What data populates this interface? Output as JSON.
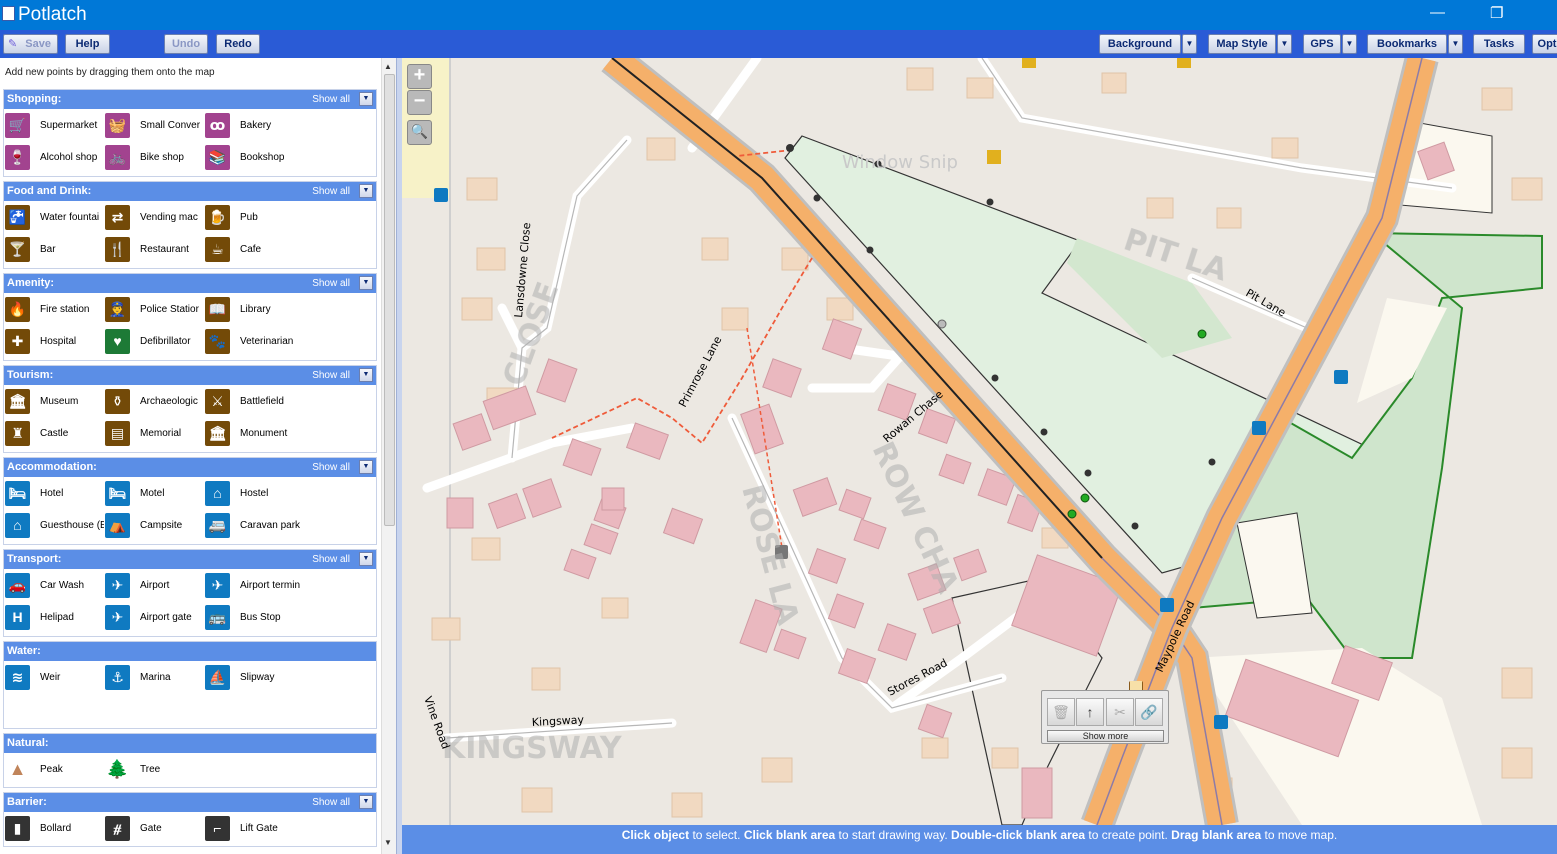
{
  "app": {
    "title": "Potlatch"
  },
  "window": {
    "minimize_glyph": "—",
    "restore_glyph": "❐"
  },
  "toolbar": {
    "save": "Save",
    "help": "Help",
    "undo": "Undo",
    "redo": "Redo",
    "background": "Background",
    "map_style": "Map Style",
    "gps": "GPS",
    "bookmarks": "Bookmarks",
    "tasks": "Tasks",
    "options": "Opt"
  },
  "panel": {
    "hint": "Add new points by dragging them onto the map",
    "show_all": "Show all",
    "categories": [
      {
        "title": "Shopping:",
        "show_all": true,
        "items": [
          {
            "label": "Supermarket",
            "icon": "cart-icon",
            "glyph": "🛒",
            "color": "#a2438f"
          },
          {
            "label": "Small Conver",
            "icon": "basket-icon",
            "glyph": "🧺",
            "color": "#a2438f"
          },
          {
            "label": "Bakery",
            "icon": "pretzel-icon",
            "glyph": "ꝏ",
            "color": "#a2438f"
          },
          {
            "label": "Alcohol shop",
            "icon": "bottle-icon",
            "glyph": "🍷",
            "color": "#a2438f"
          },
          {
            "label": "Bike shop",
            "icon": "bicycle-icon",
            "glyph": "🚲",
            "color": "#a2438f"
          },
          {
            "label": "Bookshop",
            "icon": "book-icon",
            "glyph": "📚",
            "color": "#a2438f"
          }
        ]
      },
      {
        "title": "Food and Drink:",
        "show_all": true,
        "items": [
          {
            "label": "Water fountai",
            "icon": "water-tap-icon",
            "glyph": "🚰",
            "color": "#734a08"
          },
          {
            "label": "Vending mac",
            "icon": "vending-icon",
            "glyph": "⇄",
            "color": "#734a08"
          },
          {
            "label": "Pub",
            "icon": "beer-glass-icon",
            "glyph": "🍺",
            "color": "#734a08"
          },
          {
            "label": "Bar",
            "icon": "cocktail-icon",
            "glyph": "🍸",
            "color": "#734a08"
          },
          {
            "label": "Restaurant",
            "icon": "fork-knife-icon",
            "glyph": "🍴",
            "color": "#734a08"
          },
          {
            "label": "Cafe",
            "icon": "coffee-cup-icon",
            "glyph": "☕",
            "color": "#734a08"
          }
        ]
      },
      {
        "title": "Amenity:",
        "show_all": true,
        "items": [
          {
            "label": "Fire station",
            "icon": "fire-icon",
            "glyph": "🔥",
            "color": "#734a08"
          },
          {
            "label": "Police Statior",
            "icon": "police-icon",
            "glyph": "👮",
            "color": "#734a08"
          },
          {
            "label": "Library",
            "icon": "library-book-icon",
            "glyph": "📖",
            "color": "#734a08"
          },
          {
            "label": "Hospital",
            "icon": "cross-icon",
            "glyph": "✚",
            "color": "#734a08"
          },
          {
            "label": "Defibrillator",
            "icon": "heart-icon",
            "glyph": "♥",
            "color": "#1d7a36"
          },
          {
            "label": "Veterinarian",
            "icon": "paw-icon",
            "glyph": "🐾",
            "color": "#734a08"
          }
        ]
      },
      {
        "title": "Tourism:",
        "show_all": true,
        "items": [
          {
            "label": "Museum",
            "icon": "museum-icon",
            "glyph": "🏛",
            "color": "#734a08"
          },
          {
            "label": "Archaeologic",
            "icon": "amphora-icon",
            "glyph": "⚱",
            "color": "#734a08"
          },
          {
            "label": "Battlefield",
            "icon": "swords-icon",
            "glyph": "⚔",
            "color": "#734a08"
          },
          {
            "label": "Castle",
            "icon": "castle-icon",
            "glyph": "♜",
            "color": "#734a08"
          },
          {
            "label": "Memorial",
            "icon": "plaque-icon",
            "glyph": "▤",
            "color": "#734a08"
          },
          {
            "label": "Monument",
            "icon": "monument-icon",
            "glyph": "🏛",
            "color": "#734a08"
          }
        ]
      },
      {
        "title": "Accommodation:",
        "show_all": true,
        "items": [
          {
            "label": "Hotel",
            "icon": "bed-icon",
            "glyph": "🛏",
            "color": "#0f7ac1"
          },
          {
            "label": "Motel",
            "icon": "motel-icon",
            "glyph": "🛏",
            "color": "#0f7ac1"
          },
          {
            "label": "Hostel",
            "icon": "hostel-icon",
            "glyph": "⌂",
            "color": "#0f7ac1"
          },
          {
            "label": "Guesthouse (E",
            "icon": "guesthouse-icon",
            "glyph": "⌂",
            "color": "#0f7ac1"
          },
          {
            "label": "Campsite",
            "icon": "tent-icon",
            "glyph": "⛺",
            "color": "#0f7ac1"
          },
          {
            "label": "Caravan park",
            "icon": "caravan-icon",
            "glyph": "🚐",
            "color": "#0f7ac1"
          }
        ]
      },
      {
        "title": "Transport:",
        "show_all": true,
        "items": [
          {
            "label": "Car Wash",
            "icon": "car-wash-icon",
            "glyph": "🚗",
            "color": "#0f7ac1"
          },
          {
            "label": "Airport",
            "icon": "airplane-icon",
            "glyph": "✈",
            "color": "#0f7ac1"
          },
          {
            "label": "Airport termin",
            "icon": "terminal-icon",
            "glyph": "✈",
            "color": "#0f7ac1"
          },
          {
            "label": "Helipad",
            "icon": "helipad-icon",
            "glyph": "H",
            "color": "#0f7ac1"
          },
          {
            "label": "Airport gate",
            "icon": "gate-plane-icon",
            "glyph": "✈",
            "color": "#0f7ac1"
          },
          {
            "label": "Bus Stop",
            "icon": "bus-icon",
            "glyph": "🚌",
            "color": "#0f7ac1"
          }
        ]
      },
      {
        "title": "Water:",
        "show_all": false,
        "items": [
          {
            "label": "Weir",
            "icon": "weir-icon",
            "glyph": "≋",
            "color": "#0f7ac1"
          },
          {
            "label": "Marina",
            "icon": "anchor-icon",
            "glyph": "⚓",
            "color": "#0f7ac1"
          },
          {
            "label": "Slipway",
            "icon": "slipway-icon",
            "glyph": "⛵",
            "color": "#0f7ac1"
          }
        ]
      },
      {
        "title": "Natural:",
        "show_all": false,
        "items": [
          {
            "label": "Peak",
            "icon": "peak-triangle-icon",
            "glyph": "▲",
            "color": "#ffffff"
          },
          {
            "label": "Tree",
            "icon": "tree-icon",
            "glyph": "🌲",
            "color": "#ffffff"
          }
        ]
      },
      {
        "title": "Barrier:",
        "show_all": true,
        "items": [
          {
            "label": "Bollard",
            "icon": "bollard-icon",
            "glyph": "▮",
            "color": "#333333"
          },
          {
            "label": "Gate",
            "icon": "gate-icon",
            "glyph": "⧣",
            "color": "#333333"
          },
          {
            "label": "Lift Gate",
            "icon": "lift-gate-icon",
            "glyph": "⌐",
            "color": "#333333"
          }
        ]
      }
    ]
  },
  "map": {
    "streets": [
      "Lansdowne Close",
      "Primrose Lane",
      "Rowan Chase",
      "Pit Lane",
      "Maypole Road",
      "Stores Road",
      "Kingsway",
      "Vine Road"
    ],
    "zoom_in": "+",
    "zoom_out": "−",
    "watermark": "Window Snip",
    "ground_prefix": [
      "CLOSE",
      "ROSE LA",
      "ROW CHA",
      "PIT LA",
      "KINGSWAY"
    ]
  },
  "float_panel": {
    "show_more": "Show more"
  },
  "status": {
    "p1b": "Click object",
    "p1": " to select. ",
    "p2b": "Click blank area",
    "p2": " to start drawing way. ",
    "p3b": "Double-click blank area",
    "p3": " to create point. ",
    "p4b": "Drag blank area",
    "p4": " to move map."
  },
  "colors": {
    "titlebar": "#0078d7",
    "toolbar": "#2a5bd6",
    "category_header": "#5b8ee6",
    "road": "#f5b06a",
    "building": "#eab8bf",
    "park": "#cfe5cc"
  }
}
